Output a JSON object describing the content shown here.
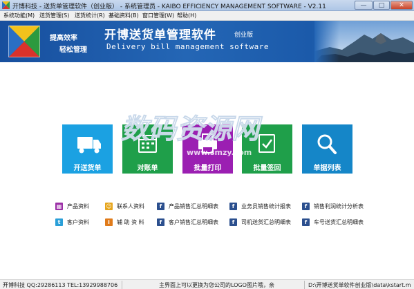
{
  "window": {
    "title": "开博科技 - 送货单管理软件（创业版） - 系统管理员 - KAIBO EFFICIENCY MANAGEMENT SOFTWARE - V2.11",
    "min_glyph": "—",
    "max_glyph": "□",
    "close_glyph": "✕"
  },
  "menu": [
    {
      "label": "系统功能(M)"
    },
    {
      "label": "送货管理(S)"
    },
    {
      "label": "送货统计(R)"
    },
    {
      "label": "基础资料(B)"
    },
    {
      "label": "窗口管理(W)"
    },
    {
      "label": "帮助(H)"
    }
  ],
  "banner": {
    "slogan_line1": "提高效率",
    "slogan_line2": "轻松管理",
    "title": "开博送货单管理软件",
    "edition": "创业版",
    "subtitle": "Delivery bill management software"
  },
  "tiles": [
    {
      "label": "开送货单",
      "icon": "truck-icon",
      "color": "#1ba1e2"
    },
    {
      "label": "对账单",
      "icon": "calendar-icon",
      "color": "#1f9f4a"
    },
    {
      "label": "批量打印",
      "icon": "print-icon",
      "color": "#9b1fb2"
    },
    {
      "label": "批量签回",
      "icon": "check-doc-icon",
      "color": "#1f9f4a"
    },
    {
      "label": "单据列表",
      "icon": "search-icon",
      "color": "#1586c8"
    }
  ],
  "watermark": {
    "text": "数码资源网",
    "url": "www.smzy.com"
  },
  "reports": [
    {
      "label": "产品资料",
      "icon": "product-icon",
      "color": "#9b2fa6",
      "glyph": "▦"
    },
    {
      "label": "联系人资料",
      "icon": "contact-icon",
      "color": "#e6a51c",
      "glyph": "☺"
    },
    {
      "label": "产品销售汇总明细表",
      "icon": "facebook-icon",
      "color": "#2b4f8e",
      "glyph": "f"
    },
    {
      "label": "业务员销售统计报表",
      "icon": "facebook-icon",
      "color": "#2b4f8e",
      "glyph": "f"
    },
    {
      "label": "销售利润统计分析表",
      "icon": "facebook-icon",
      "color": "#2b4f8e",
      "glyph": "f"
    },
    {
      "label": "客户资料",
      "icon": "twitter-icon",
      "color": "#2a9fd8",
      "glyph": "t"
    },
    {
      "label": "辅 助 资 料",
      "icon": "info-icon",
      "color": "#e07b1a",
      "glyph": "i"
    },
    {
      "label": "客户销售汇总明细表",
      "icon": "facebook-icon",
      "color": "#2b4f8e",
      "glyph": "f"
    },
    {
      "label": "司机送货汇总明细表",
      "icon": "facebook-icon",
      "color": "#2b4f8e",
      "glyph": "f"
    },
    {
      "label": "车号送货汇总明细表",
      "icon": "facebook-icon",
      "color": "#2b4f8e",
      "glyph": "f"
    }
  ],
  "status": {
    "company": "开博科技 QQ:29286113 TEL:13929988706",
    "message": "主界面上可以更换为您公司的LOGO图片哦，亲",
    "path": "D:\\开博送货单软件创业版\\data\\kstart.m"
  }
}
